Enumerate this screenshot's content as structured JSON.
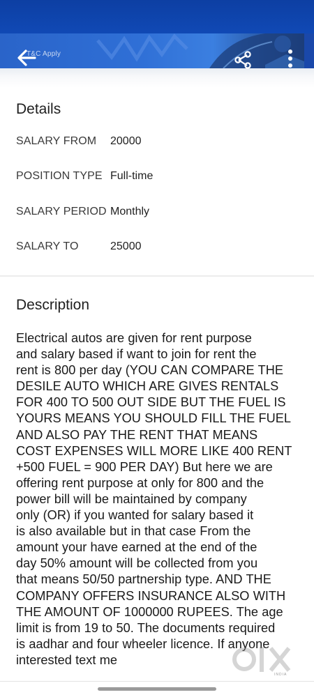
{
  "header": {
    "terms_label": "T&C Apply",
    "icons": {
      "back": "arrow-left-icon",
      "share": "share-icon",
      "more": "more-vertical-icon"
    },
    "colors": {
      "banner_primary": "#2f6fd6",
      "status_bar": "#0d3fa3"
    }
  },
  "details": {
    "title": "Details",
    "rows": [
      {
        "label": "SALARY FROM",
        "value": "20000"
      },
      {
        "label": "POSITION TYPE",
        "value": "Full-time"
      },
      {
        "label": "SALARY PERIOD",
        "value": "Monthly"
      },
      {
        "label": "SALARY TO",
        "value": "25000"
      }
    ]
  },
  "description": {
    "title": "Description",
    "lines": [
      "Electrical autos are given for rent purpose",
      "and salary based if want to join for rent the",
      "rent is 800 per day (YOU CAN COMPARE THE",
      "DESILE AUTO WHICH ARE GIVES RENTALS",
      "FOR 400 TO 500 OUT SIDE BUT THE FUEL IS",
      "YOURS MEANS YOU SHOULD FILL THE FUEL",
      "AND ALSO PAY THE RENT THAT MEANS",
      "COST EXPENSES WILL MORE LIKE 400 RENT",
      "+500 FUEL = 900 PER DAY) But here we are",
      "offering rent purpose at only for 800 and the",
      "power bill will be maintained by company",
      "only (OR) if you wanted for salary based it",
      "is also available but in that case From the",
      "amount your have earned at the end of the",
      "day 50% amount will be collected from you",
      "that means 50/50 partnership type. AND THE",
      "COMPANY OFFERS INSURANCE ALSO WITH",
      "THE AMOUNT OF 1000000 RUPEES. The age",
      "limit is from 19 to 50. The documents required",
      "is aadhar and four wheeler licence. If anyone",
      "interested text me"
    ]
  },
  "watermark": {
    "text": "OLX",
    "sub": "INDIA"
  }
}
